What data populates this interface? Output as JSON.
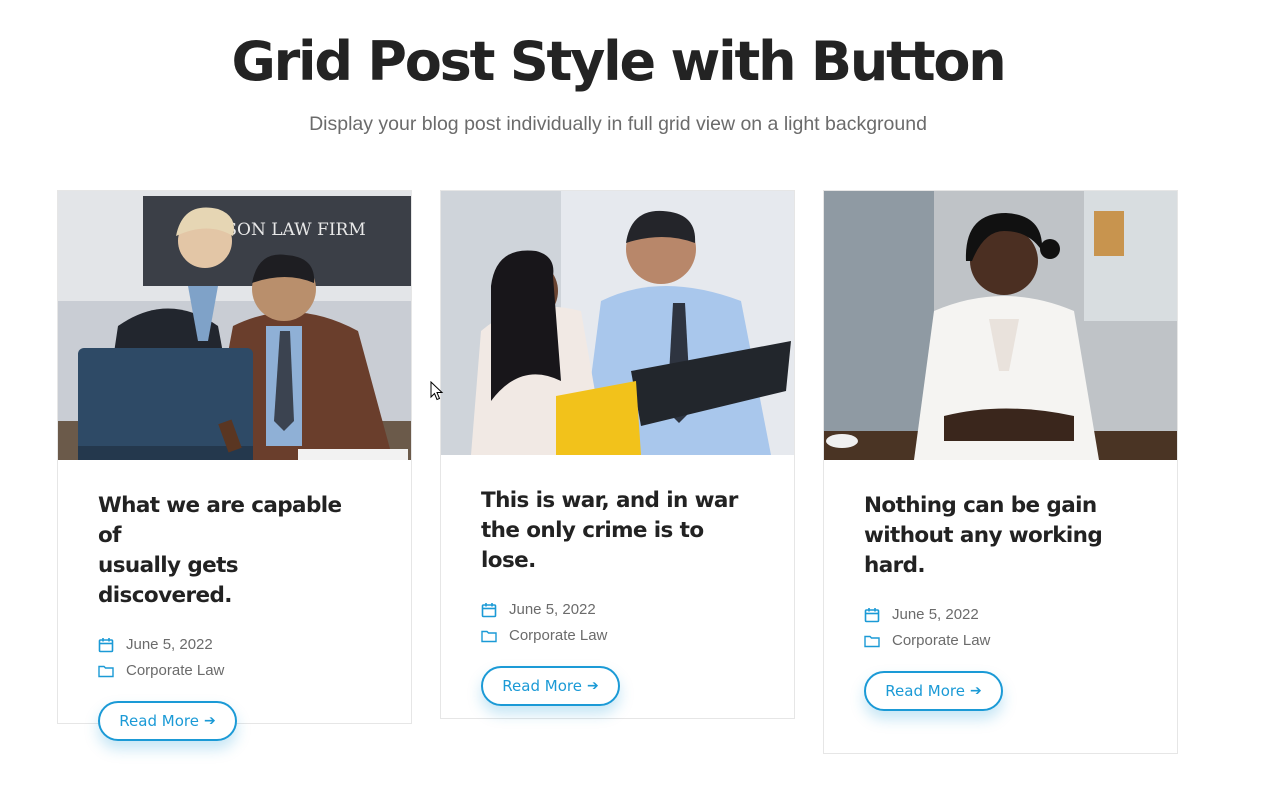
{
  "header": {
    "title": "Grid Post Style with Button",
    "subtitle": "Display your blog post individually in full grid view on a light background"
  },
  "posts": [
    {
      "title_lines": [
        "What we are capable of",
        "usually gets discovered."
      ],
      "date": "June 5, 2022",
      "category": "Corporate Law",
      "button_label": "Read More",
      "image_sign_text": "MSON LAW FIRM"
    },
    {
      "title_lines": [
        "This is war, and in war",
        "the only crime is to lose."
      ],
      "date": "June 5, 2022",
      "category": "Corporate Law",
      "button_label": "Read More"
    },
    {
      "title_lines": [
        "Nothing can be gain",
        "without any working",
        "hard."
      ],
      "date": "June 5, 2022",
      "category": "Corporate Law",
      "button_label": "Read More"
    }
  ],
  "icons": {
    "date": "calendar-icon",
    "category": "folder-icon",
    "button_arrow": "arrow-right-icon"
  },
  "colors": {
    "accent": "#1b9ad6",
    "title": "#232323",
    "muted": "#6b6b6b",
    "border": "#e6e6e6"
  }
}
